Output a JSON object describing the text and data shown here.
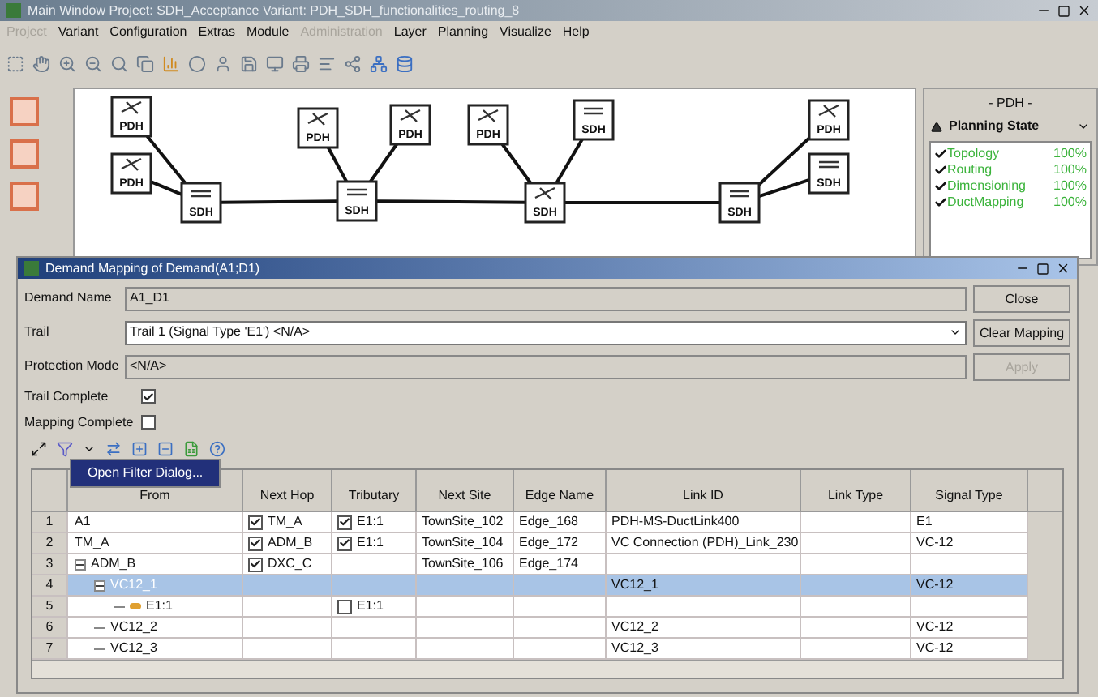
{
  "window": {
    "title": "Main Window Project: SDH_Acceptance Variant: PDH_SDH_functionalities_routing_8"
  },
  "menu": [
    {
      "label": "Project",
      "disabled": true
    },
    {
      "label": "Variant",
      "disabled": false
    },
    {
      "label": "Configuration",
      "disabled": false
    },
    {
      "label": "Extras",
      "disabled": false
    },
    {
      "label": "Module",
      "disabled": false
    },
    {
      "label": "Administration",
      "disabled": true
    },
    {
      "label": "Layer",
      "disabled": false
    },
    {
      "label": "Planning",
      "disabled": false
    },
    {
      "label": "Visualize",
      "disabled": false
    },
    {
      "label": "Help",
      "disabled": false
    }
  ],
  "diagram": {
    "nodes": [
      {
        "kind": "pdh",
        "label": "PDH"
      },
      {
        "kind": "pdh",
        "label": "PDH"
      },
      {
        "kind": "sdh",
        "label": "SDH"
      },
      {
        "kind": "pdh",
        "label": "PDH"
      },
      {
        "kind": "sdh",
        "label": "SDH"
      },
      {
        "kind": "pdh",
        "label": "PDH"
      },
      {
        "kind": "pdh",
        "label": "PDH"
      },
      {
        "kind": "sdh",
        "label": "SDH"
      },
      {
        "kind": "pdh",
        "label": "SDH"
      },
      {
        "kind": "sdh",
        "label": "SDH"
      },
      {
        "kind": "pdh",
        "label": "PDH"
      },
      {
        "kind": "sdh",
        "label": "SDH"
      }
    ]
  },
  "side_panel": {
    "title": "- PDH -",
    "dropdown": "Planning State",
    "items": [
      {
        "label": "Topology",
        "value": "100%",
        "checked": true
      },
      {
        "label": "Routing",
        "value": "100%",
        "checked": true
      },
      {
        "label": "Dimensioning",
        "value": "100%",
        "checked": true
      },
      {
        "label": "DuctMapping",
        "value": "100%",
        "checked": true
      }
    ]
  },
  "dialog": {
    "title": "Demand Mapping of Demand(A1;D1)",
    "fields": [
      {
        "label": "Demand Name",
        "value": "A1_D1",
        "kind": "readonly"
      },
      {
        "label": "Trail",
        "value": "Trail 1 (Signal Type 'E1') <N/A>",
        "kind": "dropdown"
      },
      {
        "label": "Protection Mode",
        "value": "<N/A>",
        "kind": "readonly"
      }
    ],
    "checks": [
      {
        "label": "Trail Complete",
        "checked": true
      },
      {
        "label": "Mapping Complete",
        "checked": false
      }
    ],
    "buttons": [
      {
        "label": "Close",
        "disabled": false
      },
      {
        "label": "Clear Mapping",
        "disabled": false
      },
      {
        "label": "Apply",
        "disabled": true
      }
    ],
    "menu_item": "Open Filter Dialog...",
    "table": {
      "columns": [
        "From",
        "Next Hop",
        "Tributary",
        "Next Site",
        "Edge Name",
        "Link ID",
        "Link Type",
        "Signal Type"
      ],
      "rows": [
        {
          "number": "1",
          "from": "A1",
          "next_hop": {
            "text": "TM_A",
            "checked": true
          },
          "tributary": {
            "text": "E1:1",
            "checked": true
          },
          "next_site": "TownSite_102",
          "edge_name": "Edge_168",
          "link_id": "PDH-MS-DuctLink400",
          "signal_type": "E1",
          "selected": false
        },
        {
          "number": "2",
          "from": "TM_A",
          "next_hop": {
            "text": "ADM_B",
            "checked": true
          },
          "tributary": {
            "text": "E1:1",
            "checked": true
          },
          "next_site": "TownSite_104",
          "edge_name": "Edge_172",
          "link_id": "VC Connection (PDH)_Link_230",
          "signal_type": "VC-12",
          "selected": false
        },
        {
          "number": "3",
          "from": "ADM_B",
          "expanded": true,
          "next_hop": {
            "text": "DXC_C",
            "checked": true
          },
          "next_site": "TownSite_106",
          "edge_name": "Edge_174",
          "selected": false,
          "children": [
            {
              "number": "4",
              "from": "VC12_1",
              "expanded": true,
              "link_id": "VC12_1",
              "signal_type": "VC-12",
              "selected": true,
              "children": [
                {
                  "number": "5",
                  "from": "E1:1",
                  "kind": "port",
                  "tributary": {
                    "text": "E1:1",
                    "checked": false
                  },
                  "selected": false
                }
              ]
            },
            {
              "number": "6",
              "from": "VC12_2",
              "link_id": "VC12_2",
              "signal_type": "VC-12",
              "selected": false
            },
            {
              "number": "7",
              "from": "VC12_3",
              "link_id": "VC12_3",
              "signal_type": "VC-12",
              "selected": false
            }
          ]
        }
      ]
    }
  }
}
